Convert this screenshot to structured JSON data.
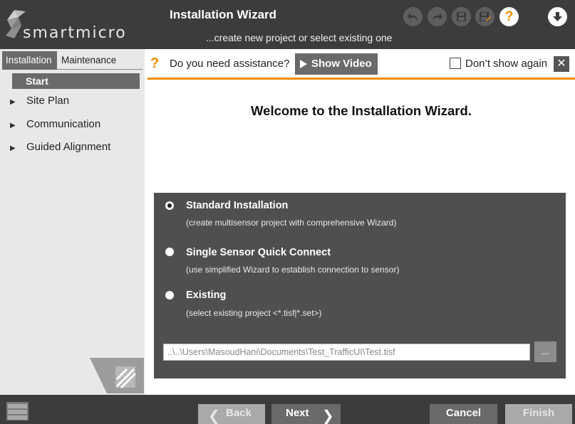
{
  "header": {
    "logo_text": "smartmicro",
    "title": "Installation Wizard",
    "subtitle": "...create new project or select existing one",
    "buttons": [
      "undo-icon",
      "redo-icon",
      "save-icon",
      "save-as-icon",
      "help-icon",
      "download-icon"
    ],
    "help_glyph": "?"
  },
  "sidebar": {
    "tabs": [
      {
        "label": "Installation",
        "active": true
      },
      {
        "label": "Maintenance",
        "active": false
      }
    ],
    "items": [
      {
        "label": "Start",
        "selected": true
      },
      {
        "label": "Site Plan",
        "expandable": true
      },
      {
        "label": "Communication",
        "expandable": true
      },
      {
        "label": "Guided Alignment",
        "expandable": true
      }
    ]
  },
  "assist": {
    "question_mark": "?",
    "text": "Do you need assistance?",
    "video_button": "Show Video",
    "dont_show_label": "Don’t show again",
    "dont_show_checked": false,
    "close_glyph": "✕"
  },
  "main": {
    "welcome": "Welcome to the Installation Wizard.",
    "options": [
      {
        "title": "Standard Installation",
        "desc": "(create multisensor project with comprehensive Wizard)",
        "selected": true
      },
      {
        "title": "Single Sensor Quick Connect",
        "desc": "(use simplified Wizard to establish connection to sensor)",
        "selected": false
      },
      {
        "title": "Existing",
        "desc": "(select existing project <*.tisf|*.set>)",
        "selected": false
      }
    ],
    "path_value": "..\\..\\Users\\MasoudHani\\Documents\\Test_TrafficUI\\Test.tisf",
    "browse_label": "..."
  },
  "footer": {
    "back": "Back",
    "next": "Next",
    "cancel": "Cancel",
    "finish": "Finish"
  },
  "colors": {
    "header_bg": "#3c3c3e",
    "accent": "#f28c00",
    "panel_bg": "#4f4f51",
    "sidebar_bg": "#e8e8e8"
  }
}
